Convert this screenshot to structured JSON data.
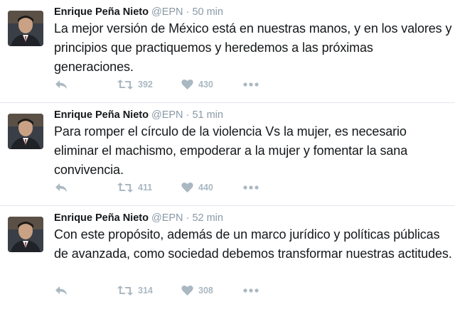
{
  "tweets": [
    {
      "author_name": "Enrique Peña Nieto",
      "handle": "@EPN",
      "separator": "·",
      "time": "50 min",
      "text": "La mejor versión de México está en nuestras manos, y en los valores y principios que practiquemos y heredemos a las próximas generaciones.",
      "retweets": "392",
      "likes": "430"
    },
    {
      "author_name": "Enrique Peña Nieto",
      "handle": "@EPN",
      "separator": "·",
      "time": "51 min",
      "text": "Para romper el círculo de la violencia Vs la mujer, es necesario eliminar el machismo, empoderar a la mujer  y fomentar la sana convivencia.",
      "retweets": "411",
      "likes": "440"
    },
    {
      "author_name": "Enrique Peña Nieto",
      "handle": "@EPN",
      "separator": "·",
      "time": "52 min",
      "text": "Con este propósito, además de un marco jurídico y políticas públicas de avanzada, como sociedad debemos transformar nuestras actitudes.",
      "retweets": "314",
      "likes": "308"
    }
  ],
  "icons": {
    "reply": "reply-icon",
    "retweet": "retweet-icon",
    "like": "heart-icon",
    "more": "more-dots-icon"
  },
  "colors": {
    "text": "#14171a",
    "secondary": "#8899a6",
    "action_icon": "#aab8c2",
    "divider": "#e1e8ed"
  }
}
